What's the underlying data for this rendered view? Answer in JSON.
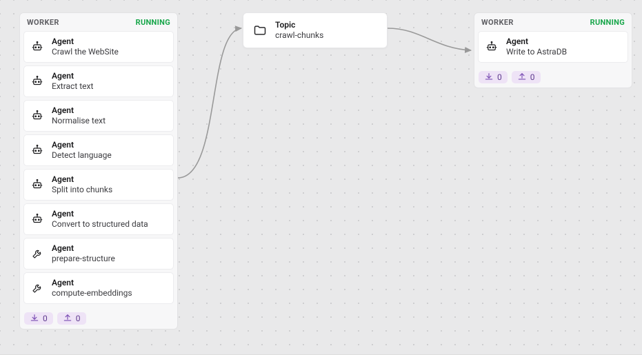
{
  "labels": {
    "worker": "WORKER",
    "running": "RUNNING",
    "agent": "Agent",
    "topic": "Topic"
  },
  "worker1": {
    "agents": [
      {
        "title": "Agent",
        "desc": "Crawl the WebSite",
        "icon": "robot"
      },
      {
        "title": "Agent",
        "desc": "Extract text",
        "icon": "robot"
      },
      {
        "title": "Agent",
        "desc": "Normalise text",
        "icon": "robot"
      },
      {
        "title": "Agent",
        "desc": "Detect language",
        "icon": "robot"
      },
      {
        "title": "Agent",
        "desc": "Split into chunks",
        "icon": "robot"
      },
      {
        "title": "Agent",
        "desc": "Convert to structured data",
        "icon": "robot"
      },
      {
        "title": "Agent",
        "desc": "prepare-structure",
        "icon": "wrench"
      },
      {
        "title": "Agent",
        "desc": "compute-embeddings",
        "icon": "wrench"
      }
    ],
    "in_count": "0",
    "out_count": "0"
  },
  "topic": {
    "title": "Topic",
    "name": "crawl-chunks"
  },
  "worker2": {
    "agents": [
      {
        "title": "Agent",
        "desc": "Write to AstraDB",
        "icon": "robot"
      }
    ],
    "in_count": "0",
    "out_count": "0"
  }
}
